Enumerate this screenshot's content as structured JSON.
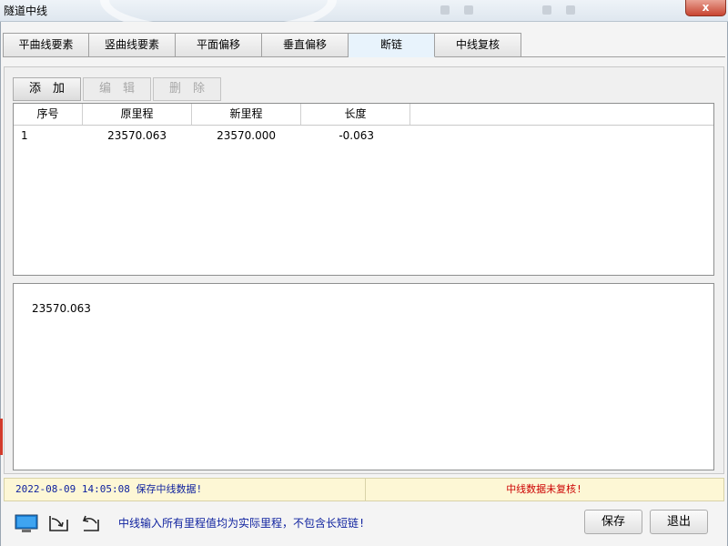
{
  "window": {
    "title": "隧道中线",
    "close_label": "x"
  },
  "tabs": [
    {
      "label": "平曲线要素",
      "active": false
    },
    {
      "label": "竖曲线要素",
      "active": false
    },
    {
      "label": "平面偏移",
      "active": false
    },
    {
      "label": "垂直偏移",
      "active": false
    },
    {
      "label": "断链",
      "active": true
    },
    {
      "label": "中线复核",
      "active": false
    }
  ],
  "toolbar": {
    "add_label": "添　加",
    "edit_label": "编　辑",
    "delete_label": "删　除"
  },
  "table": {
    "columns": [
      "序号",
      "原里程",
      "新里程",
      "长度"
    ],
    "rows": [
      [
        "1",
        "23570.063",
        "23570.000",
        "-0.063"
      ]
    ]
  },
  "detail": {
    "value": "23570.063"
  },
  "status": {
    "left": "2022-08-09 14:05:08 保存中线数据!",
    "right": "中线数据未复核!",
    "left_color": "#0c1f9e",
    "right_color": "#cc0000"
  },
  "footer": {
    "icons": [
      "monitor-icon",
      "import-icon",
      "undo-icon"
    ],
    "hint": "中线输入所有里程值均为实际里程，不包含长短链!",
    "save_label": "保存",
    "exit_label": "退出"
  }
}
